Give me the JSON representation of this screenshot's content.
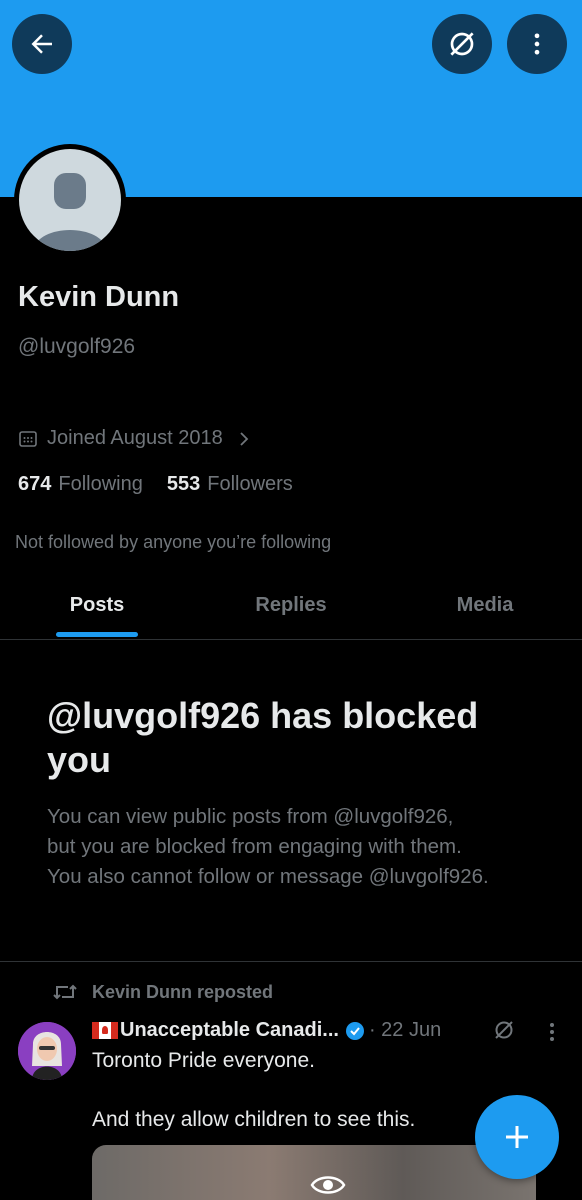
{
  "header": {
    "back_icon": "arrow-left-icon",
    "blocked_icon": "slashed-circle-icon",
    "more_icon": "vertical-dots-icon",
    "banner_color": "#1d9bf0"
  },
  "profile": {
    "name": "Kevin Dunn",
    "handle": "@luvgolf926",
    "joined": "Joined August 2018",
    "following_count": "674",
    "following_label": "Following",
    "followers_count": "553",
    "followers_label": "Followers",
    "not_followed_text": "Not followed by anyone you’re following"
  },
  "tabs": [
    {
      "label": "Posts",
      "active": true
    },
    {
      "label": "Replies",
      "active": false
    },
    {
      "label": "Media",
      "active": false
    }
  ],
  "blocked": {
    "title": "@luvgolf926 has blocked you",
    "line1": "You can view public posts from @luvgolf926,",
    "line2": "but you are blocked from engaging with them.",
    "line3": "You also cannot follow or message @luvgolf926."
  },
  "post": {
    "repost_label": "Kevin Dunn reposted",
    "author": "Unacceptable Canadi...",
    "time": "· 22 Jun",
    "line1": "Toronto Pride everyone.",
    "line2": "And they allow children to see this."
  },
  "fab": {
    "label": "+"
  },
  "colors": {
    "accent": "#1d9bf0",
    "muted": "#71767b",
    "text": "#e7e9ea"
  }
}
